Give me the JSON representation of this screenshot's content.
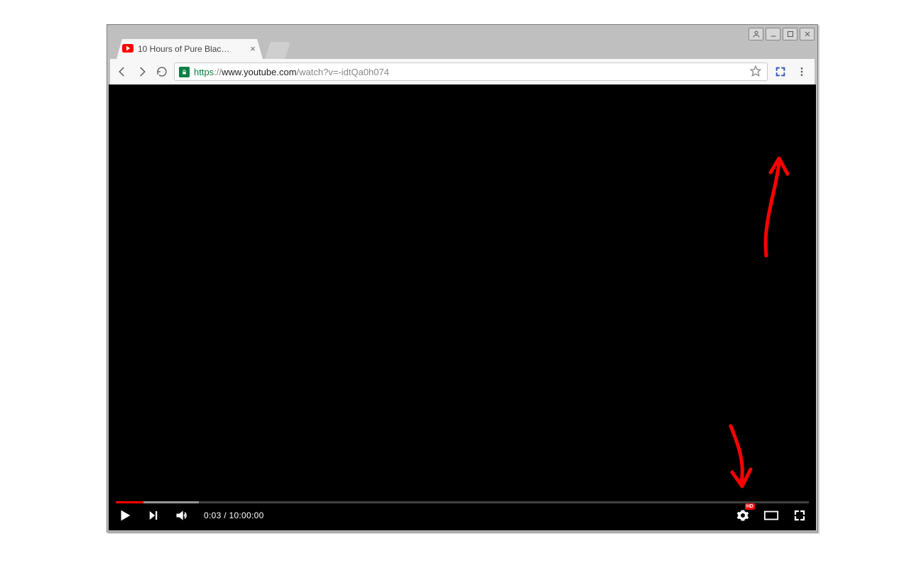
{
  "window_controls": {
    "user": "user",
    "min": "min",
    "max": "max",
    "close": "close"
  },
  "tab": {
    "title": "10 Hours of Pure Blac…",
    "favicon": "youtube"
  },
  "url": {
    "scheme": "https",
    "sep": "://",
    "host": "www.youtube.com",
    "path": "/watch?v=-idtQa0h074"
  },
  "player": {
    "time_current": "0:03",
    "time_separator": " / ",
    "time_total": "10:00:00",
    "progress_played_pct": 0.4,
    "progress_buffered_pct": 12,
    "hd_label": "HD"
  },
  "annotations": {
    "color": "#ff0000"
  }
}
